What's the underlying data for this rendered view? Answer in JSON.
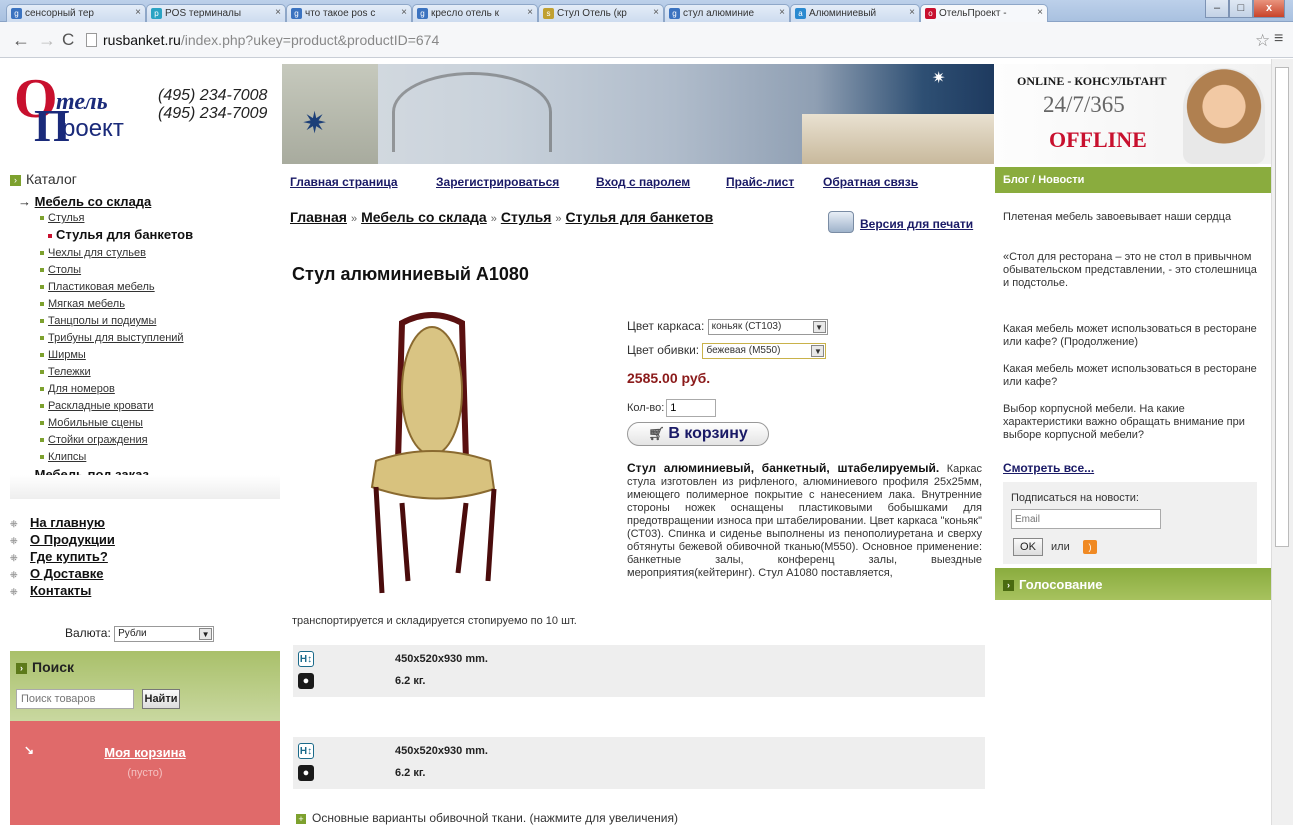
{
  "browser": {
    "tabs": [
      {
        "label": "сенсорный тер",
        "active": false
      },
      {
        "label": "POS терминалы",
        "active": false
      },
      {
        "label": "что такое pos с",
        "active": false
      },
      {
        "label": "кресло отель к",
        "active": false
      },
      {
        "label": "Стул Отель (кр",
        "active": false
      },
      {
        "label": "стул алюминие",
        "active": false
      },
      {
        "label": "Алюминиевый",
        "active": false
      },
      {
        "label": "ОтельПроект -",
        "active": true
      }
    ],
    "url_host": "rusbanket.ru",
    "url_path": "/index.php?ukey=product&productID=674"
  },
  "header": {
    "logo_top": "тель",
    "logo_bottom": "роект",
    "phone1": "(495) 234-7008",
    "phone2": "(495) 234-7009",
    "consult_title": "ONLINE - КОНСУЛЬТАНТ",
    "consult_hours": "24/7/365",
    "consult_status": "OFFLINE"
  },
  "catalog": {
    "title": "Каталог",
    "items": [
      {
        "label": "Мебель со склада",
        "level": 1
      },
      {
        "label": "Стулья",
        "level": 2
      },
      {
        "label": "Стулья для банкетов",
        "level": 3
      },
      {
        "label": "Чехлы для стульев",
        "level": 2
      },
      {
        "label": "Столы",
        "level": 2
      },
      {
        "label": "Пластиковая мебель",
        "level": 2
      },
      {
        "label": "Мягкая мебель",
        "level": 2
      },
      {
        "label": "Танцполы и подиумы",
        "level": 2
      },
      {
        "label": "Трибуны для выступлений",
        "level": 2
      },
      {
        "label": "Ширмы",
        "level": 2
      },
      {
        "label": "Тележки",
        "level": 2
      },
      {
        "label": "Для номеров",
        "level": 2
      },
      {
        "label": "Раскладные кровати",
        "level": 2
      },
      {
        "label": "Мобильные сцены",
        "level": 2
      },
      {
        "label": "Стойки ограждения",
        "level": 2
      },
      {
        "label": "Клипсы",
        "level": 2
      },
      {
        "label": "Мебель под заказ",
        "level": 1
      }
    ]
  },
  "side_links": [
    "На главную",
    "О Продукции",
    "Где купить?",
    "О Доставке",
    "Контакты"
  ],
  "currency": {
    "label": "Валюта:",
    "value": "Рубли"
  },
  "search": {
    "title": "Поиск",
    "placeholder": "Поиск товаров",
    "button": "Найти"
  },
  "cart": {
    "title": "Моя корзина",
    "status": "(пусто)"
  },
  "topmenu": [
    "Главная страница",
    "Зарегистрироваться",
    "Вход с паролем",
    "Прайс-лист",
    "Обратная связь"
  ],
  "breadcrumbs": [
    "Главная",
    "Мебель со склада",
    "Стулья",
    "Стулья для банкетов"
  ],
  "breadcrumb_sep": "»",
  "print_label": "Версия для печати",
  "product": {
    "title": "Стул алюминиевый А1080",
    "frame_label": "Цвет каркаса:",
    "frame_value": "коньяк (СТ103)",
    "upholstery_label": "Цвет обивки:",
    "upholstery_value": "бежевая (М550)",
    "price": "2585.00 руб.",
    "qty_label": "Кол-во:",
    "qty_value": "1",
    "add_to_cart": "В корзину",
    "desc_bold": "Стул алюминиевый, банкетный, штабелируемый.",
    "desc_text": "Каркас стула изготовлен из рифленого, алюминиевого профиля 25х25мм, имеющего полимерное покрытие с нанесением лака. Внутренние стороны ножек оснащены пластиковыми бобышками для предотвращении износа при штабелировании. Цвет каркаса \"коньяк\"(СТ03). Спинка и сиденье выполнены из пенополиуретана и сверху обтянуты бежевой обивочной тканью(М550). Основное применение: банкетные залы, конференц залы, выездные мероприятия(кейтеринг). Стул А1080 поставляется,",
    "desc_tail": "транспортируется и складируется стопируемо по 10 шт.",
    "specs": [
      {
        "size": "450x520x930 mm.",
        "weight": "6.2 кг."
      },
      {
        "size": "450x520x930 mm.",
        "weight": "6.2 кг."
      }
    ],
    "fabric_note": "Основные варианты обивочной ткани. (нажмите для увеличения)"
  },
  "blog": {
    "title": "Блог / Новости",
    "posts": [
      "Плетеная мебель завоевывает наши сердца",
      "«Стол для ресторана – это не стол в привычном обывательском представлении, - это столешница и подстолье.",
      "Какая мебель может использоваться в ресторане или кафе? (Продолжение)",
      "Какая мебель может использоваться в ресторане или кафе?",
      "Выбор корпусной мебели. На какие характеристики важно обращать внимание при выборе корпусной мебели?"
    ],
    "more": "Смотреть все...",
    "subscribe_label": "Подписаться на новости:",
    "subscribe_placeholder": "Email",
    "ok": "OK",
    "or": "или",
    "vote_title": "Голосование"
  },
  "colors": {
    "accent_green": "#8aac3e",
    "brand_red": "#c8102e",
    "price": "#8b1a1a",
    "cart_bg": "#e06a6a"
  },
  "icons": [
    "back-icon",
    "forward-icon",
    "reload-icon",
    "star-icon",
    "menu-icon",
    "printer-icon",
    "cart-icon",
    "rss-icon",
    "height-icon",
    "weight-icon"
  ]
}
